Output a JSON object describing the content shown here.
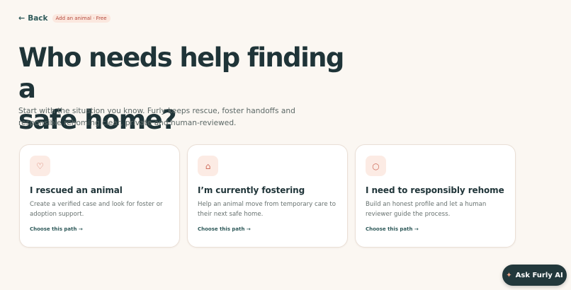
{
  "nav": {
    "back_icon": "←",
    "back_label": "Back",
    "badge": "Add an animal · Free"
  },
  "hero": {
    "title_line1": "Who needs help finding a",
    "title_line2": "safe home?",
    "subtitle": "Start with the situation you know. Furly keeps rescue, foster handoffs and responsible rehoming clear, private and human-reviewed."
  },
  "cards": [
    {
      "icon": "♡",
      "icon_name": "heart-icon",
      "title": "I rescued an animal",
      "text": "Create a verified case and look for foster or adoption support.",
      "link": "Choose this path →"
    },
    {
      "icon": "⌂",
      "icon_name": "home-icon",
      "title": "I’m currently fostering",
      "text": "Help an animal move from temporary care to their next safe home.",
      "link": "Choose this path →"
    },
    {
      "icon": "○",
      "icon_name": "circle-icon",
      "title": "I need to responsibly rehome",
      "text": "Build an honest profile and let a human reviewer guide the process.",
      "link": "Choose this path →"
    }
  ],
  "assistant": {
    "icon": "✦",
    "label": "Ask Furly AI"
  },
  "colors": {
    "background": "#fbf7f2",
    "heading": "#1f3438",
    "accent": "#2f5a5a",
    "icon_bg": "#fcebe4",
    "icon_fg": "#cf6e5d",
    "badge_bg": "#fbe8df",
    "badge_fg": "#b5483b",
    "assistant_bg": "#22383c"
  }
}
